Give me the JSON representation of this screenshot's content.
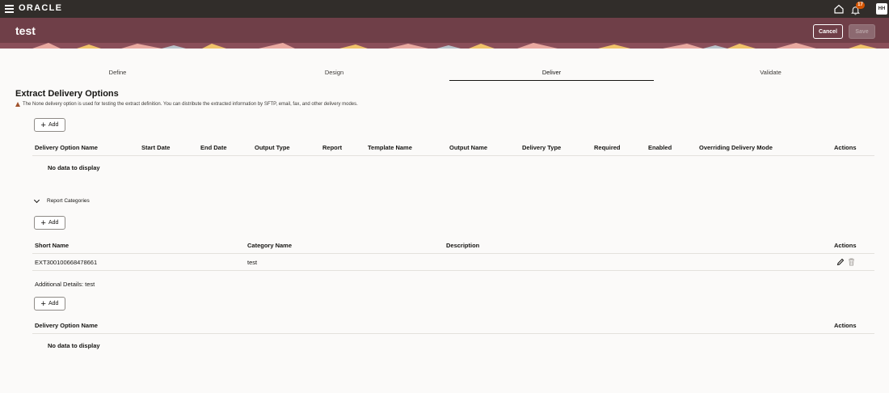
{
  "topbar": {
    "brand": "ORACLE",
    "notification_count": "17",
    "avatar_initials": "HH"
  },
  "header": {
    "title": "test",
    "cancel_label": "Cancel",
    "save_label": "Save"
  },
  "tabs": [
    {
      "label": "Define"
    },
    {
      "label": "Design"
    },
    {
      "label": "Deliver",
      "active": true
    },
    {
      "label": "Validate"
    }
  ],
  "section": {
    "title": "Extract Delivery Options",
    "warning": "The None delivery option is used for testing the extract definition. You can distribute the extracted information by SFTP, email, fax, and other delivery modes."
  },
  "add_label": "Add",
  "delivery_table": {
    "columns": [
      "Delivery Option Name",
      "Start Date",
      "End Date",
      "Output Type",
      "Report",
      "Template Name",
      "Output Name",
      "Delivery Type",
      "Required",
      "Enabled",
      "Overriding Delivery Mode",
      "Actions"
    ],
    "empty_text": "No data to display"
  },
  "report_categories": {
    "label": "Report Categories",
    "columns": [
      "Short Name",
      "Category Name",
      "Description",
      "Actions"
    ],
    "rows": [
      {
        "short_name": "EXT300100668478661",
        "category_name": "test",
        "description": ""
      }
    ]
  },
  "additional": {
    "label": "Additional Details: test",
    "columns": [
      "Delivery Option Name",
      "Actions"
    ],
    "empty_text": "No data to display"
  },
  "colors": {
    "topbar": "#312d2a",
    "banner": "#6f3f48",
    "badge": "#d35400"
  }
}
